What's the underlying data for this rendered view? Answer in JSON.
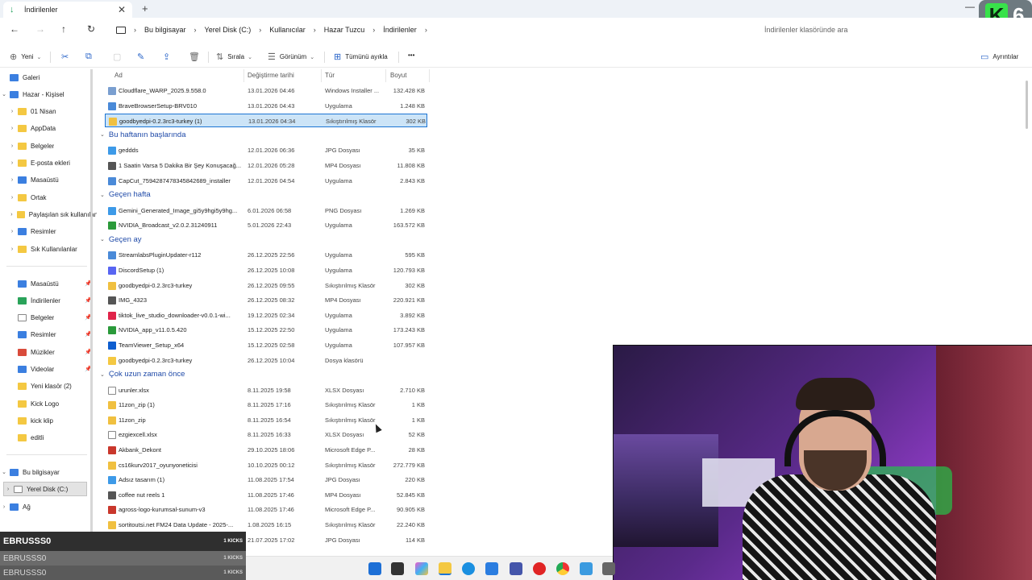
{
  "window": {
    "tab_title": "İndirilenler",
    "tab_close": "✕",
    "new_tab": "+",
    "minimize": "—"
  },
  "channel_logo": {
    "letter": "K",
    "number": "6"
  },
  "address": {
    "crumbs": [
      "Bu bilgisayar",
      "Yerel Disk (C:)",
      "Kullanıcılar",
      "Hazar Tuzcu",
      "İndirilenler"
    ],
    "search_placeholder": "İndirilenler klasöründe ara"
  },
  "toolbar": {
    "new_label": "Yeni",
    "sort_label": "Sırala",
    "view_label": "Görünüm",
    "select_all_label": "Tümünü ayıkla",
    "more_label": "•••",
    "details_label": "Ayrıntılar"
  },
  "sidebar": {
    "gallery": "Galeri",
    "home_personal": "Hazar - Kişisel",
    "tree": [
      "01 Nisan",
      "AppData",
      "Belgeler",
      "E-posta ekleri",
      "Masaüstü",
      "Ortak",
      "Paylaşılan sık kullanılanlar",
      "Resimler",
      "Sık Kullanılanlar"
    ],
    "quick": [
      "Masaüstü",
      "İndirilenler",
      "Belgeler",
      "Resimler",
      "Müzikler",
      "Videolar",
      "Yeni klasör (2)",
      "Kick Logo",
      "kick klip",
      "editli"
    ],
    "this_pc": "Bu bilgisayar",
    "local_disk": "Yerel Disk (C:)",
    "network": "Ağ"
  },
  "columns": {
    "name": "Ad",
    "date": "Değiştirme tarihi",
    "type": "Tür",
    "size": "Boyut"
  },
  "groups": {
    "start_of_week": "Bu haftanın başlarında",
    "last_week": "Geçen hafta",
    "last_month": "Geçen ay",
    "long_ago": "Çok uzun zaman önce"
  },
  "files_today": [
    {
      "name": "Cloudflare_WARP_2025.9.558.0",
      "date": "13.01.2026 04:46",
      "type": "Windows Installer ...",
      "size": "132.428 KB",
      "icon": "installer"
    },
    {
      "name": "BraveBrowserSetup-BRV010",
      "date": "13.01.2026 04:43",
      "type": "Uygulama",
      "size": "1.248 KB",
      "icon": "app"
    },
    {
      "name": "goodbyedpi-0.2.3rc3-turkey (1)",
      "date": "13.01.2026 04:34",
      "type": "Sıkıştırılmış Klasör",
      "size": "302 KB",
      "icon": "zip"
    }
  ],
  "files_week_start": [
    {
      "name": "geddds",
      "date": "12.01.2026 06:36",
      "type": "JPG Dosyası",
      "size": "35 KB",
      "icon": "image"
    },
    {
      "name": "1 Saatin Varsa 5 Dakika Bir Şey Konuşacağ...",
      "date": "12.01.2026 05:28",
      "type": "MP4 Dosyası",
      "size": "11.808 KB",
      "icon": "video"
    },
    {
      "name": "CapCut_7594287478345842689_installer",
      "date": "12.01.2026 04:54",
      "type": "Uygulama",
      "size": "2.843 KB",
      "icon": "app"
    }
  ],
  "files_last_week": [
    {
      "name": "Gemini_Generated_Image_gi5y9hgi5y9hg...",
      "date": "6.01.2026 06:58",
      "type": "PNG Dosyası",
      "size": "1.269 KB",
      "icon": "image"
    },
    {
      "name": "NVIDIA_Broadcast_v2.0.2.31240911",
      "date": "5.01.2026 22:43",
      "type": "Uygulama",
      "size": "163.572 KB",
      "icon": "nvidia"
    }
  ],
  "files_last_month": [
    {
      "name": "StreamlabsPluginUpdater-r112",
      "date": "26.12.2025 22:56",
      "type": "Uygulama",
      "size": "595 KB",
      "icon": "app"
    },
    {
      "name": "DiscordSetup (1)",
      "date": "26.12.2025 10:08",
      "type": "Uygulama",
      "size": "120.793 KB",
      "icon": "discord"
    },
    {
      "name": "goodbyedpi-0.2.3rc3-turkey",
      "date": "26.12.2025 09:55",
      "type": "Sıkıştırılmış Klasör",
      "size": "302 KB",
      "icon": "zip"
    },
    {
      "name": "IMG_4323",
      "date": "26.12.2025 08:32",
      "type": "MP4 Dosyası",
      "size": "220.921 KB",
      "icon": "video"
    },
    {
      "name": "tiktok_live_studio_downloader-v0.0.1-wi...",
      "date": "19.12.2025 02:34",
      "type": "Uygulama",
      "size": "3.892 KB",
      "icon": "tiktok"
    },
    {
      "name": "NVIDIA_app_v11.0.5.420",
      "date": "15.12.2025 22:50",
      "type": "Uygulama",
      "size": "173.243 KB",
      "icon": "nvidia"
    },
    {
      "name": "TeamViewer_Setup_x64",
      "date": "15.12.2025 02:58",
      "type": "Uygulama",
      "size": "107.957 KB",
      "icon": "teamviewer"
    },
    {
      "name": "goodbyedpi-0.2.3rc3-turkey",
      "date": "26.12.2025 10:04",
      "type": "Dosya klasörü",
      "size": "",
      "icon": "folder"
    }
  ],
  "files_long_ago": [
    {
      "name": "urunler.xlsx",
      "date": "8.11.2025 19:58",
      "type": "XLSX Dosyası",
      "size": "2.710 KB",
      "icon": "doc"
    },
    {
      "name": "11zon_zip (1)",
      "date": "8.11.2025 17:16",
      "type": "Sıkıştırılmış Klasör",
      "size": "1 KB",
      "icon": "zip"
    },
    {
      "name": "11zon_zip",
      "date": "8.11.2025 16:54",
      "type": "Sıkıştırılmış Klasör",
      "size": "1 KB",
      "icon": "zip"
    },
    {
      "name": "ezgiexcell.xlsx",
      "date": "8.11.2025 16:33",
      "type": "XLSX Dosyası",
      "size": "52 KB",
      "icon": "doc"
    },
    {
      "name": "Akbank_Dekont",
      "date": "29.10.2025 18:06",
      "type": "Microsoft Edge P...",
      "size": "28 KB",
      "icon": "pdf"
    },
    {
      "name": "cs16kurv2017_oyunyoneticisi",
      "date": "10.10.2025 00:12",
      "type": "Sıkıştırılmış Klasör",
      "size": "272.779 KB",
      "icon": "zip"
    },
    {
      "name": "Adsız tasarım (1)",
      "date": "11.08.2025 17:54",
      "type": "JPG Dosyası",
      "size": "220 KB",
      "icon": "image"
    },
    {
      "name": "coffee nut reels 1",
      "date": "11.08.2025 17:46",
      "type": "MP4 Dosyası",
      "size": "52.845 KB",
      "icon": "video"
    },
    {
      "name": "agross-logo-kurumsal-sunum-v3",
      "date": "11.08.2025 17:46",
      "type": "Microsoft Edge P...",
      "size": "90.905 KB",
      "icon": "pdf"
    },
    {
      "name": "sortitoutsi.net FM24 Data Update - 2025-...",
      "date": "1.08.2025 16:15",
      "type": "Sıkıştırılmış Klasör",
      "size": "22.240 KB",
      "icon": "zip"
    },
    {
      "name": "",
      "date": "21.07.2025 17:02",
      "type": "JPG Dosyası",
      "size": "114 KB",
      "icon": "image"
    }
  ],
  "kick_overlay": {
    "main_user": "EBRUSSS0",
    "main_amount": "1 KICKS",
    "sub1_user": "EBRUSSS0",
    "sub1_amount": "1 KICKS",
    "sub2_user": "EBRUSSS0",
    "sub2_amount": "1 KICKS"
  },
  "colors": {
    "accent": "#1c74d4",
    "selection": "#cce4f7",
    "group_header": "#1f4aa8",
    "folder": "#f4c842",
    "kick_green": "#38e24a"
  }
}
